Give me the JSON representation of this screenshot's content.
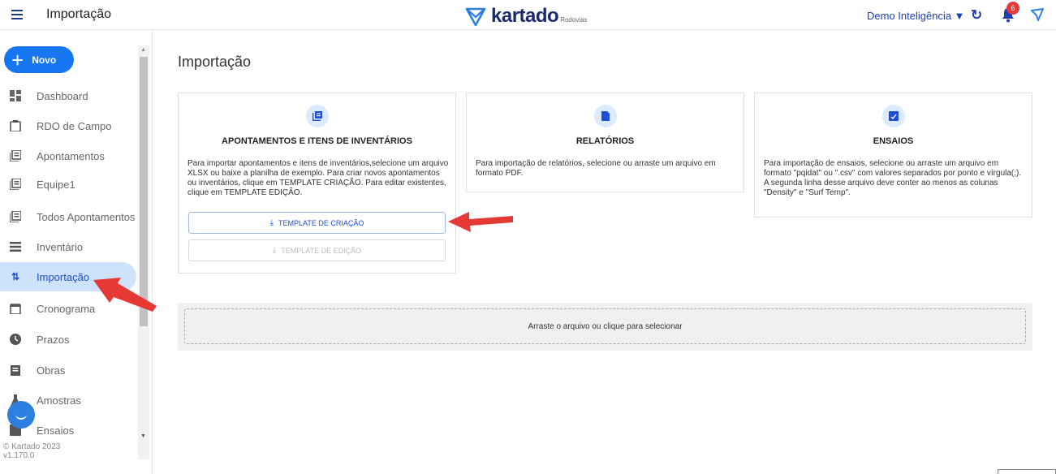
{
  "header": {
    "title": "Importação",
    "logo_word": "kartado",
    "logo_sub": "Rodovias",
    "user": "Demo Inteligência ▼",
    "notifications": "6"
  },
  "sidebar": {
    "new_button": "Novo",
    "items": [
      {
        "label": "Dashboard",
        "icon": "dashboard-icon"
      },
      {
        "label": "RDO de Campo",
        "icon": "clipboard-icon"
      },
      {
        "label": "Apontamentos",
        "icon": "library-icon"
      },
      {
        "label": "Equipe1",
        "icon": "library-icon"
      },
      {
        "label": "Todos Apontamentos",
        "icon": "library-icon"
      },
      {
        "label": "Inventário",
        "icon": "list-icon"
      },
      {
        "label": "Importação",
        "icon": "import-export-icon"
      },
      {
        "label": "Cronograma",
        "icon": "calendar-icon"
      },
      {
        "label": "Prazos",
        "icon": "clock-icon"
      },
      {
        "label": "Obras",
        "icon": "assignment-icon"
      },
      {
        "label": "Amostras",
        "icon": "flask-icon"
      },
      {
        "label": "Ensaios",
        "icon": "assessment-icon"
      }
    ],
    "copyright": "© Kartado 2023",
    "version": "v1.170.0"
  },
  "main": {
    "title": "Importação",
    "cards": [
      {
        "title": "APONTAMENTOS E ITENS DE INVENTÁRIOS",
        "text": "Para importar apontamentos e itens de inventários,selecione um arquivo XLSX ou baixe a planilha de exemplo. Para criar novos apontamentos ou inventários, clique em TEMPLATE CRIAÇÃO. Para editar existentes, clique em TEMPLATE EDIÇÃO.",
        "btn_create": "TEMPLATE DE CRIAÇÃO",
        "btn_edit": "TEMPLATE DE EDIÇÃO"
      },
      {
        "title": "RELATÓRIOS",
        "text": "Para importação de relatórios, selecione ou arraste um arquivo em formato PDF."
      },
      {
        "title": "ENSAIOS",
        "text": "Para importação de ensaios, selecione ou arraste um arquivo em formato \"pqidat\" ou \".csv\" com valores separados por ponto e vírgula(;). A segunda linha desse arquivo deve conter ao menos as colunas \"Density\" e \"Surf Temp\"."
      }
    ],
    "dropzone": "Arraste o arquivo ou clique para selecionar"
  },
  "colors": {
    "primary": "#1976f2",
    "active_bg": "#cfe2fb",
    "annotation_arrow": "#e53935"
  }
}
